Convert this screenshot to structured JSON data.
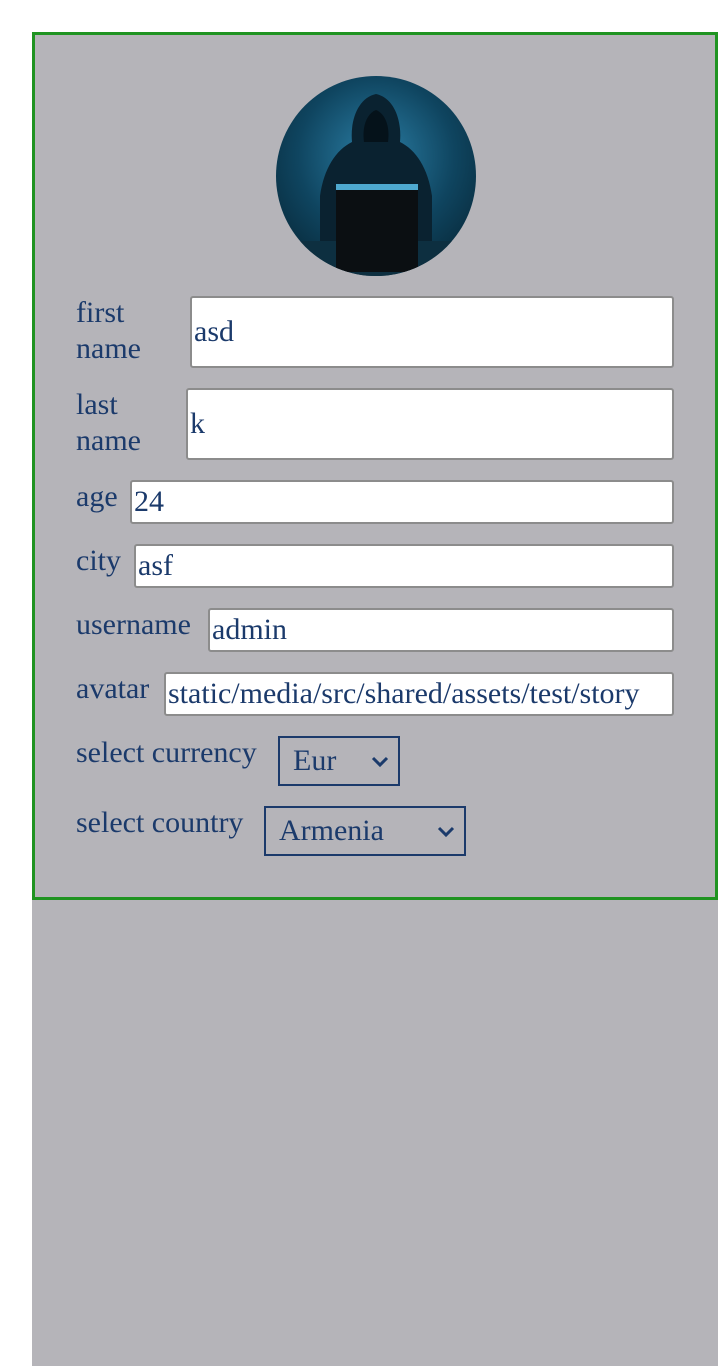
{
  "profile": {
    "avatar_icon": "hooded-hacker-avatar",
    "fields": {
      "first_name": {
        "label": "first name",
        "value": "asd"
      },
      "last_name": {
        "label": "last name",
        "value": "k"
      },
      "age": {
        "label": "age",
        "value": "24"
      },
      "city": {
        "label": "city",
        "value": "asf"
      },
      "username": {
        "label": "username",
        "value": "admin"
      },
      "avatar": {
        "label": "avatar",
        "value": "static/media/src/shared/assets/test/story"
      }
    },
    "currency": {
      "label": "select currency",
      "selected": "Eur"
    },
    "country": {
      "label": "select country",
      "selected": "Armenia"
    }
  },
  "colors": {
    "background": "#b5b4b9",
    "card_border": "#1f9321",
    "text": "#1b3a6b"
  }
}
